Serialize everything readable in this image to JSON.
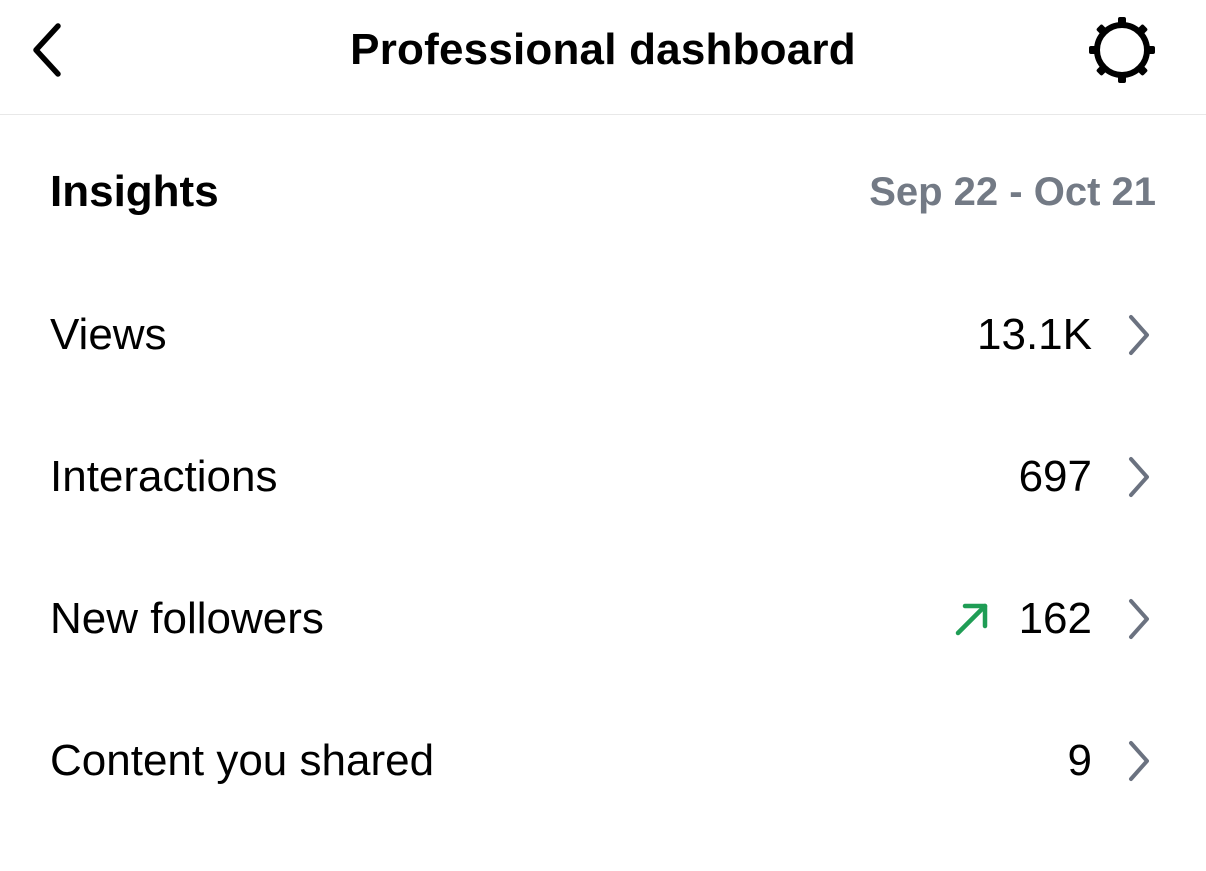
{
  "header": {
    "title": "Professional dashboard",
    "back_icon": "chevron-left-icon",
    "settings_icon": "gear-icon"
  },
  "insights": {
    "title": "Insights",
    "date_range": "Sep 22 - Oct 21"
  },
  "metrics": [
    {
      "label": "Views",
      "value": "13.1K",
      "trend": ""
    },
    {
      "label": "Interactions",
      "value": "697",
      "trend": ""
    },
    {
      "label": "New followers",
      "value": "162",
      "trend": "up"
    },
    {
      "label": "Content you shared",
      "value": "9",
      "trend": ""
    }
  ],
  "colors": {
    "secondary_text": "#737a85",
    "trend_up": "#1f9d55",
    "chevron": "#6b7280",
    "divider": "#e8e8e8"
  }
}
